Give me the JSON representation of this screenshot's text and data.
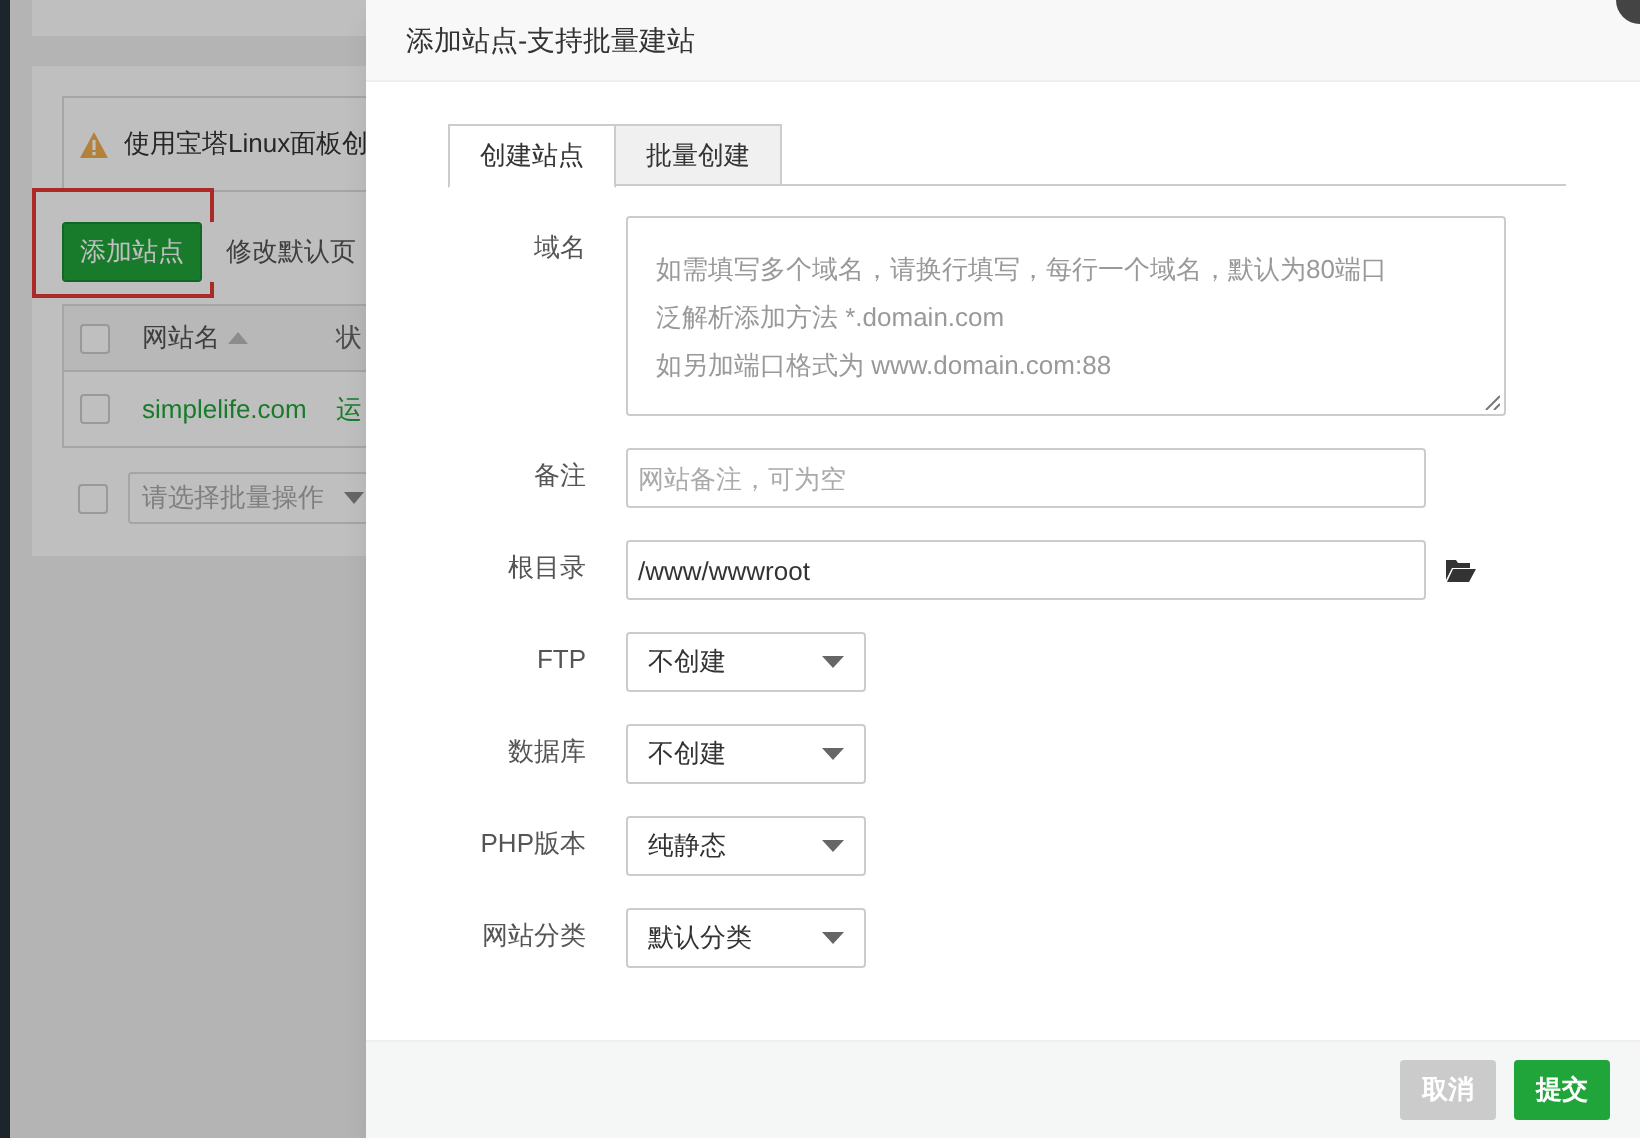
{
  "background_page": {
    "alert": "使用宝塔Linux面板创",
    "buttons": [
      {
        "label": "添加站点",
        "primary": true,
        "highlighted": true
      },
      {
        "label": "修改默认页",
        "primary": false,
        "highlighted": false
      }
    ],
    "table": {
      "all_checked": false,
      "columns": [
        {
          "label": "网站名",
          "sorted": true
        },
        {
          "label": "状",
          "sorted": false
        }
      ],
      "rows": [
        {
          "checked": false,
          "cells": [
            "simplelife.com",
            "运"
          ]
        }
      ]
    },
    "batch_select": {
      "checked": false,
      "placeholder": "请选择批量操作"
    }
  },
  "dialog": {
    "title": "添加站点-支持批量建站",
    "tabs": [
      {
        "label": "创建站点",
        "selected": true
      },
      {
        "label": "批量创建",
        "selected": false
      }
    ],
    "fields": [
      {
        "kind": "textarea",
        "label": "域名",
        "placeholder_lines": [
          "如需填写多个域名，请换行填写，每行一个域名，默认为80端口",
          "泛解析添加方法 *.domain.com",
          "如另加端口格式为 www.domain.com:88"
        ]
      },
      {
        "kind": "input",
        "label": "备注",
        "placeholder": "网站备注，可为空"
      },
      {
        "kind": "path",
        "label": "根目录",
        "value": "/www/wwwroot"
      },
      {
        "kind": "select",
        "label": "FTP",
        "value": "不创建"
      },
      {
        "kind": "select",
        "label": "数据库",
        "value": "不创建"
      },
      {
        "kind": "select",
        "label": "PHP版本",
        "value": "纯静态"
      },
      {
        "kind": "select",
        "label": "网站分类",
        "value": "默认分类"
      }
    ],
    "buttons": [
      {
        "label": "取消",
        "primary": false
      },
      {
        "label": "提交",
        "primary": true
      }
    ]
  }
}
